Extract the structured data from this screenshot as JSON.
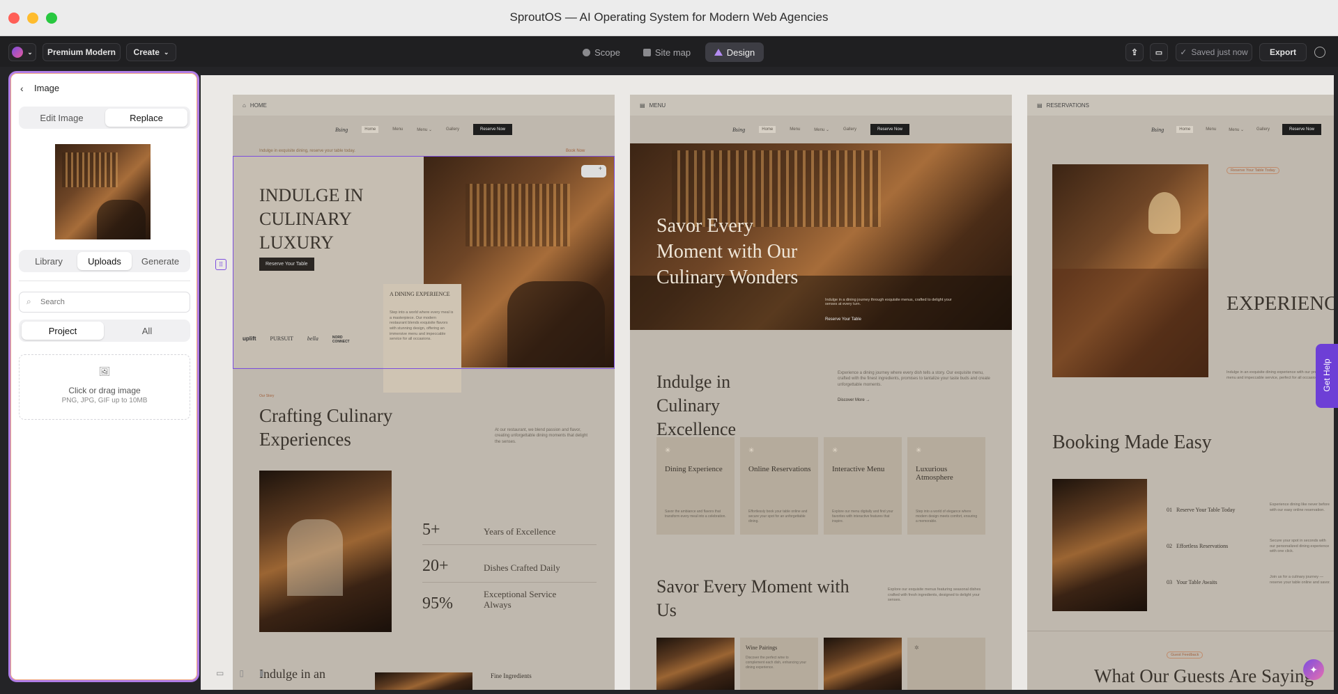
{
  "window": {
    "title": "SproutOS — AI Operating System for Modern Web Agencies"
  },
  "toolbar": {
    "project_name": "Premium Modern",
    "create_label": "Create",
    "tabs": [
      {
        "label": "Scope"
      },
      {
        "label": "Site map"
      },
      {
        "label": "Design"
      }
    ],
    "saved_label": "Saved just now",
    "export_label": "Export"
  },
  "panel": {
    "back_title": "Image",
    "mode_tabs": [
      {
        "label": "Edit Image"
      },
      {
        "label": "Replace"
      }
    ],
    "source_tabs": [
      {
        "label": "Library"
      },
      {
        "label": "Uploads"
      },
      {
        "label": "Generate"
      }
    ],
    "search_placeholder": "Search",
    "scope_tabs": [
      {
        "label": "Project"
      },
      {
        "label": "All"
      }
    ],
    "dropzone_title": "Click or drag image",
    "dropzone_hint": "PNG, JPG, GIF up to 10MB"
  },
  "frames": {
    "home": {
      "label": "HOME",
      "nav": {
        "logo": "Bsing",
        "items": [
          "Home",
          "Menu",
          "Menu ⌄",
          "Gallery"
        ],
        "cta": "Reserve Now"
      },
      "announcement": "Indulge in exquisite dining, reserve your table today.",
      "announcement_link": "Book Now",
      "hero_title": "INDULGE IN CULINARY LUXURY",
      "hero_button": "Reserve Your Table",
      "overlay_title": "A DINING EXPERIENCE",
      "overlay_text": "Step into a world where every meal is a masterpiece. Our modern restaurant blends exquisite flavors with stunning design, offering an immersive menu and impeccable service for all occasions.",
      "logos": [
        "uplift",
        "PURSUIT",
        "bella",
        "NORD CONNECT"
      ],
      "story_tag": "Our Story",
      "story_title": "Crafting Culinary Experiences",
      "story_text": "At our restaurant, we blend passion and flavor, creating unforgettable dining moments that delight the senses.",
      "stats": [
        {
          "value": "5+",
          "label": "Years of Excellence"
        },
        {
          "value": "20+",
          "label": "Dishes Crafted Daily"
        },
        {
          "value": "95%",
          "label": "Exceptional Service Always"
        }
      ],
      "next_title": "Indulge in an",
      "next_label": "Fine Ingredients"
    },
    "menu": {
      "label": "MENU",
      "nav": {
        "logo": "Bsing",
        "items": [
          "Home",
          "Menu",
          "Menu ⌄",
          "Gallery"
        ],
        "cta": "Reserve Now"
      },
      "hero_title": "Savor Every Moment with Our Culinary Wonders",
      "hero_text": "Indulge in a dining journey through exquisite menus, crafted to delight your senses at every turn.",
      "hero_button": "Reserve Your Table",
      "intro_title": "Indulge in Culinary Excellence",
      "intro_text": "Experience a dining journey where every dish tells a story. Our exquisite menu, crafted with the finest ingredients, promises to tantalize your taste buds and create unforgettable moments.",
      "intro_link": "Discover More →",
      "cards": [
        {
          "title": "Dining Experience",
          "text": "Savor the ambiance and flavors that transform every meal into a celebration."
        },
        {
          "title": "Online Reservations",
          "text": "Effortlessly book your table online and secure your spot for an unforgettable dining."
        },
        {
          "title": "Interactive Menu",
          "text": "Explore our menu digitally and find your favorites with interactive features that inspire."
        },
        {
          "title": "Luxurious Atmosphere",
          "text": "Step into a world of elegance where modern design meets comfort, ensuring a memorable."
        }
      ],
      "savor_title": "Savor Every Moment with Us",
      "savor_text": "Explore our exquisite menus featuring seasonal dishes crafted with fresh ingredients, designed to delight your senses.",
      "wine_title": "Wine Pairings",
      "wine_text": "Discover the perfect wine to complement each dish, enhancing your dining experience."
    },
    "reservations": {
      "label": "RESERVATIONS",
      "nav": {
        "logo": "Bsing",
        "items": [
          "Home",
          "Menu",
          "Menu ⌄",
          "Gallery"
        ],
        "cta": "Reserve Now"
      },
      "tag": "Reserve Your Table Today",
      "hero_title": "EXPERIENCE CULINARY LUXURY",
      "hero_text": "Indulge in an exquisite dining experience with our premium menu and impeccable service, perfect for all occasions.",
      "booking_title": "Booking Made Easy",
      "steps": [
        {
          "num": "01",
          "title": "Reserve Your Table Today",
          "text": "Experience dining like never before with our easy online reservation."
        },
        {
          "num": "02",
          "title": "Effortless Reservations",
          "text": "Secure your spot in seconds with our personalized dining experience with one click."
        },
        {
          "num": "03",
          "title": "Your Table Awaits",
          "text": "Join us for a culinary journey — reserve your table online and savor."
        }
      ],
      "feedback_tag": "Guest Feedback",
      "feedback_title": "What Our Guests Are Saying"
    }
  },
  "get_help": "Get Help",
  "colors": {
    "accent": "#7c4dde",
    "panel_border": "#b07ee8",
    "canvas": "#ebe9e6"
  }
}
